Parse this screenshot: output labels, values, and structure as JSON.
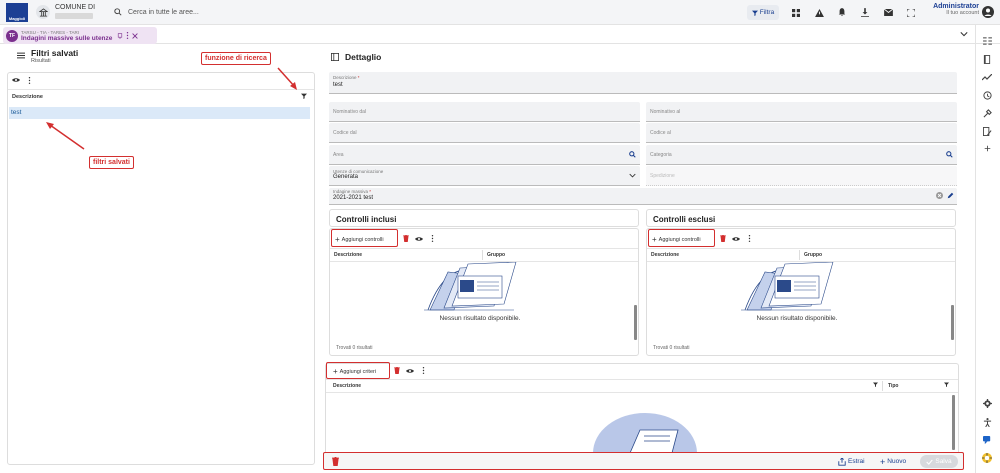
{
  "topbar": {
    "logo_text": "Maggioli",
    "org_name": "COMUNE DI",
    "search_placeholder": "Cerca in tutte le aree...",
    "filter_label": "Filtra",
    "user_name": "Administrator",
    "user_role": "Il tuo account"
  },
  "tab": {
    "badge": "TF",
    "subtitle": "TARSU - TIA - TARES - TARI",
    "title": "Indagini massive sulle utenze"
  },
  "left_panel": {
    "title": "Filtri salvati",
    "subtitle": "Risultati",
    "column_header": "Descrizione",
    "rows": [
      "test"
    ]
  },
  "right_panel": {
    "title": "Dettaglio",
    "fields": {
      "descrizione_label": "Descrizione",
      "descrizione_value": "test",
      "nominativo_dal": "Nominativo dal",
      "nominativo_al": "Nominativo al",
      "codice_dal": "Codice dal",
      "codice_al": "Codice al",
      "area": "Area",
      "categoria": "Categoria",
      "utenze_label": "Utenze di comunicazione",
      "utenze_value": "Generata",
      "spedizione": "Spedizione",
      "indagine_label": "Indagine massiva",
      "indagine_value": "2021-2021 test"
    },
    "controlli_inclusi": {
      "title": "Controlli inclusi",
      "add_label": "Aggiungi controlli",
      "col1": "Descrizione",
      "col2": "Gruppo",
      "empty": "Nessun risultato disponibile.",
      "found": "Trovati 0 risultati"
    },
    "controlli_esclusi": {
      "title": "Controlli esclusi",
      "add_label": "Aggiungi controlli",
      "col1": "Descrizione",
      "col2": "Gruppo",
      "empty": "Nessun risultato disponibile.",
      "found": "Trovati 0 risultati"
    },
    "criteri": {
      "add_label": "Aggiungi criteri",
      "col1": "Descrizione",
      "col2": "Tipo"
    }
  },
  "footer": {
    "estrai": "Estrai",
    "nuovo": "Nuovo",
    "salva": "Salva"
  },
  "annotations": {
    "funzione": "funzione di ricerca",
    "filtri": "filtri salvati"
  },
  "colors": {
    "brand": "#1c3f94",
    "tab_accent": "#7b2f8e",
    "annotation": "#d32f2f",
    "selection": "#dbe9f8"
  }
}
